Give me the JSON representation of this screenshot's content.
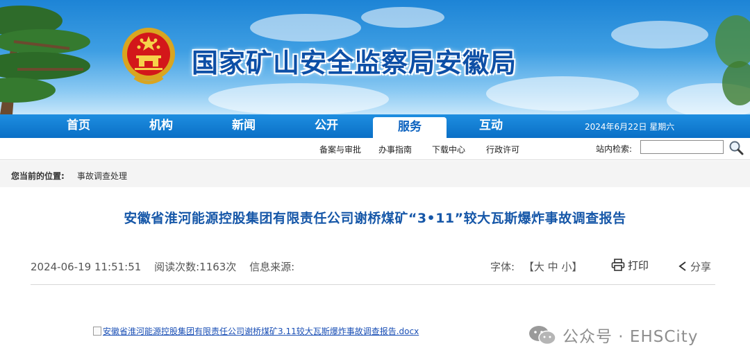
{
  "header": {
    "site_title": "国家矿山安全监察局安徽局"
  },
  "nav": {
    "items": [
      "首页",
      "机构",
      "新闻",
      "公开",
      "服务",
      "互动"
    ],
    "active_index": 4,
    "date": "2024年6月22日 星期六"
  },
  "subnav": {
    "items": [
      "备案与审批",
      "办事指南",
      "下载中心",
      "行政许可"
    ],
    "search_label": "站内检索:",
    "search_value": ""
  },
  "breadcrumb": {
    "label": "您当前的位置:",
    "current": "事故调查处理"
  },
  "article": {
    "title": "安徽省淮河能源控股集团有限责任公司谢桥煤矿“3•11”较大瓦斯爆炸事故调查报告",
    "datetime": "2024-06-19 11:51:51",
    "views": "阅读次数:1163次",
    "source": "信息来源:",
    "font_label": "字体:",
    "font_open": "【",
    "font_large": "大",
    "font_medium": "中",
    "font_small": "小",
    "font_close": "】",
    "print_label": "打印",
    "share_label": "分享",
    "attachment": "安徽省淮河能源控股集团有限责任公司谢桥煤矿3.11较大瓦斯爆炸事故调查报告.docx"
  },
  "watermark": {
    "text": "公众号 · EHSCity"
  },
  "colors": {
    "nav_blue": "#0a6fc6",
    "title_blue": "#1657a8",
    "link_blue": "#1a4fb5"
  }
}
